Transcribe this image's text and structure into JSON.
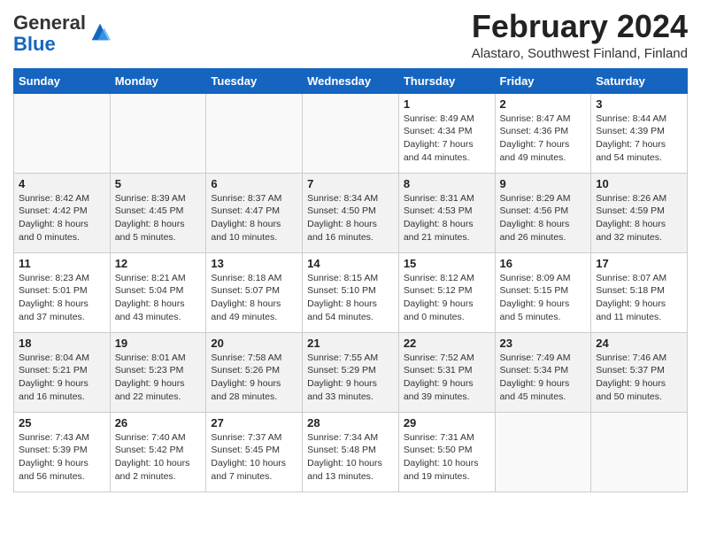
{
  "header": {
    "logo_general": "General",
    "logo_blue": "Blue",
    "month_year": "February 2024",
    "location": "Alastaro, Southwest Finland, Finland"
  },
  "weekdays": [
    "Sunday",
    "Monday",
    "Tuesday",
    "Wednesday",
    "Thursday",
    "Friday",
    "Saturday"
  ],
  "weeks": [
    [
      {
        "day": "",
        "info": ""
      },
      {
        "day": "",
        "info": ""
      },
      {
        "day": "",
        "info": ""
      },
      {
        "day": "",
        "info": ""
      },
      {
        "day": "1",
        "info": "Sunrise: 8:49 AM\nSunset: 4:34 PM\nDaylight: 7 hours\nand 44 minutes."
      },
      {
        "day": "2",
        "info": "Sunrise: 8:47 AM\nSunset: 4:36 PM\nDaylight: 7 hours\nand 49 minutes."
      },
      {
        "day": "3",
        "info": "Sunrise: 8:44 AM\nSunset: 4:39 PM\nDaylight: 7 hours\nand 54 minutes."
      }
    ],
    [
      {
        "day": "4",
        "info": "Sunrise: 8:42 AM\nSunset: 4:42 PM\nDaylight: 8 hours\nand 0 minutes."
      },
      {
        "day": "5",
        "info": "Sunrise: 8:39 AM\nSunset: 4:45 PM\nDaylight: 8 hours\nand 5 minutes."
      },
      {
        "day": "6",
        "info": "Sunrise: 8:37 AM\nSunset: 4:47 PM\nDaylight: 8 hours\nand 10 minutes."
      },
      {
        "day": "7",
        "info": "Sunrise: 8:34 AM\nSunset: 4:50 PM\nDaylight: 8 hours\nand 16 minutes."
      },
      {
        "day": "8",
        "info": "Sunrise: 8:31 AM\nSunset: 4:53 PM\nDaylight: 8 hours\nand 21 minutes."
      },
      {
        "day": "9",
        "info": "Sunrise: 8:29 AM\nSunset: 4:56 PM\nDaylight: 8 hours\nand 26 minutes."
      },
      {
        "day": "10",
        "info": "Sunrise: 8:26 AM\nSunset: 4:59 PM\nDaylight: 8 hours\nand 32 minutes."
      }
    ],
    [
      {
        "day": "11",
        "info": "Sunrise: 8:23 AM\nSunset: 5:01 PM\nDaylight: 8 hours\nand 37 minutes."
      },
      {
        "day": "12",
        "info": "Sunrise: 8:21 AM\nSunset: 5:04 PM\nDaylight: 8 hours\nand 43 minutes."
      },
      {
        "day": "13",
        "info": "Sunrise: 8:18 AM\nSunset: 5:07 PM\nDaylight: 8 hours\nand 49 minutes."
      },
      {
        "day": "14",
        "info": "Sunrise: 8:15 AM\nSunset: 5:10 PM\nDaylight: 8 hours\nand 54 minutes."
      },
      {
        "day": "15",
        "info": "Sunrise: 8:12 AM\nSunset: 5:12 PM\nDaylight: 9 hours\nand 0 minutes."
      },
      {
        "day": "16",
        "info": "Sunrise: 8:09 AM\nSunset: 5:15 PM\nDaylight: 9 hours\nand 5 minutes."
      },
      {
        "day": "17",
        "info": "Sunrise: 8:07 AM\nSunset: 5:18 PM\nDaylight: 9 hours\nand 11 minutes."
      }
    ],
    [
      {
        "day": "18",
        "info": "Sunrise: 8:04 AM\nSunset: 5:21 PM\nDaylight: 9 hours\nand 16 minutes."
      },
      {
        "day": "19",
        "info": "Sunrise: 8:01 AM\nSunset: 5:23 PM\nDaylight: 9 hours\nand 22 minutes."
      },
      {
        "day": "20",
        "info": "Sunrise: 7:58 AM\nSunset: 5:26 PM\nDaylight: 9 hours\nand 28 minutes."
      },
      {
        "day": "21",
        "info": "Sunrise: 7:55 AM\nSunset: 5:29 PM\nDaylight: 9 hours\nand 33 minutes."
      },
      {
        "day": "22",
        "info": "Sunrise: 7:52 AM\nSunset: 5:31 PM\nDaylight: 9 hours\nand 39 minutes."
      },
      {
        "day": "23",
        "info": "Sunrise: 7:49 AM\nSunset: 5:34 PM\nDaylight: 9 hours\nand 45 minutes."
      },
      {
        "day": "24",
        "info": "Sunrise: 7:46 AM\nSunset: 5:37 PM\nDaylight: 9 hours\nand 50 minutes."
      }
    ],
    [
      {
        "day": "25",
        "info": "Sunrise: 7:43 AM\nSunset: 5:39 PM\nDaylight: 9 hours\nand 56 minutes."
      },
      {
        "day": "26",
        "info": "Sunrise: 7:40 AM\nSunset: 5:42 PM\nDaylight: 10 hours\nand 2 minutes."
      },
      {
        "day": "27",
        "info": "Sunrise: 7:37 AM\nSunset: 5:45 PM\nDaylight: 10 hours\nand 7 minutes."
      },
      {
        "day": "28",
        "info": "Sunrise: 7:34 AM\nSunset: 5:48 PM\nDaylight: 10 hours\nand 13 minutes."
      },
      {
        "day": "29",
        "info": "Sunrise: 7:31 AM\nSunset: 5:50 PM\nDaylight: 10 hours\nand 19 minutes."
      },
      {
        "day": "",
        "info": ""
      },
      {
        "day": "",
        "info": ""
      }
    ]
  ]
}
